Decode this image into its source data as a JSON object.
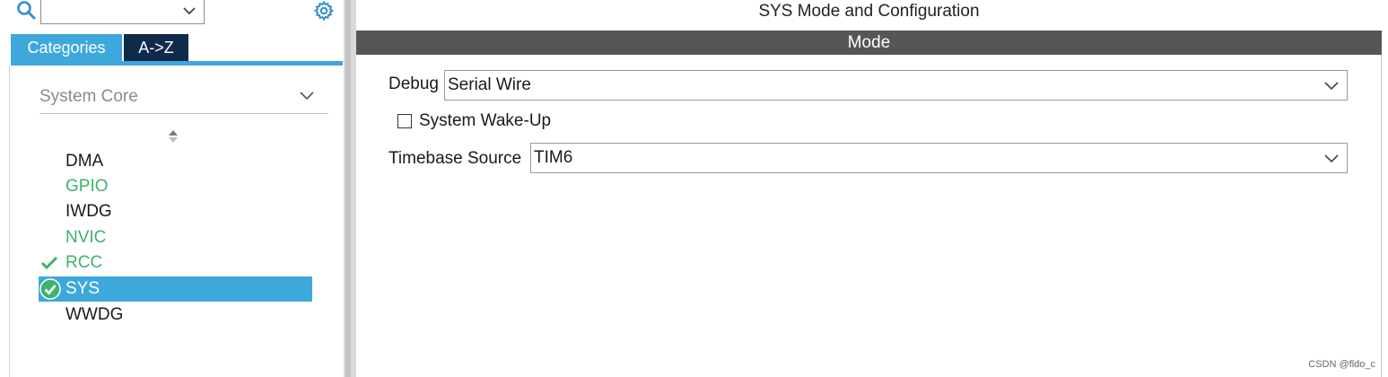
{
  "left": {
    "search": {
      "value": ""
    },
    "tabs": [
      {
        "label": "Categories",
        "active": true
      },
      {
        "label": "A->Z",
        "active": false
      }
    ],
    "category": {
      "selected": "System Core"
    },
    "items": [
      {
        "label": "DMA",
        "status": "none"
      },
      {
        "label": "GPIO",
        "status": "configured"
      },
      {
        "label": "IWDG",
        "status": "none"
      },
      {
        "label": "NVIC",
        "status": "configured"
      },
      {
        "label": "RCC",
        "status": "checked"
      },
      {
        "label": "SYS",
        "status": "selected-checked"
      },
      {
        "label": "WWDG",
        "status": "none"
      }
    ]
  },
  "right": {
    "title": "SYS Mode and Configuration",
    "mode_header": "Mode",
    "debug": {
      "label": "Debug",
      "value": "Serial Wire"
    },
    "wakeup": {
      "label": "System Wake-Up",
      "checked": false
    },
    "timebase": {
      "label": "Timebase Source",
      "value": "TIM6"
    }
  },
  "watermark": "CSDN @fldo_c",
  "colors": {
    "accent": "#3ea8dd",
    "tab_dark": "#0f2a4a",
    "configured_green": "#3db36b",
    "mode_header_bg": "#565656"
  },
  "icons": [
    "search-icon",
    "gear-icon",
    "chevron-down-icon",
    "sort-icon",
    "check-icon",
    "check-circle-icon"
  ]
}
